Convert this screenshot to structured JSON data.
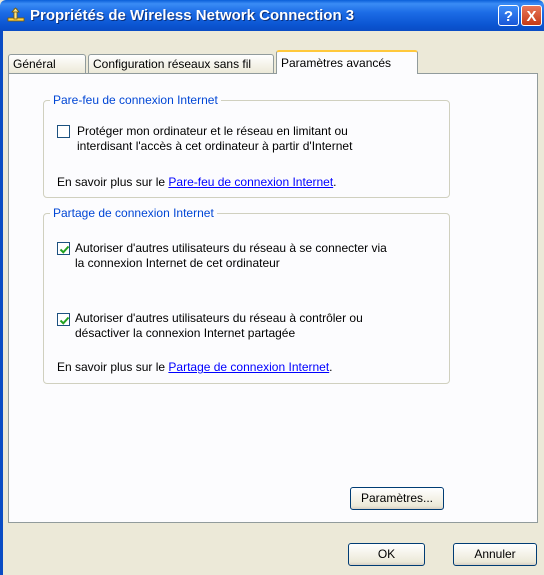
{
  "window": {
    "title": "Propriétés de Wireless Network Connection 3",
    "help_label": "?",
    "close_label": "X"
  },
  "tabs": [
    {
      "label": "Général"
    },
    {
      "label": "Configuration réseaux sans fil"
    },
    {
      "label": "Paramètres avancés",
      "active": true
    }
  ],
  "firewall": {
    "legend": "Pare-feu de connexion Internet",
    "checkbox_line1": "Protéger mon ordinateur et le réseau en limitant ou",
    "checkbox_line2": "interdisant l'accès à cet ordinateur à partir d'Internet",
    "checked": false,
    "learn_prefix": "En savoir plus sur le ",
    "learn_link": "Pare-feu de connexion Internet",
    "learn_suffix": "."
  },
  "sharing": {
    "legend": "Partage de connexion Internet",
    "opt1_line1": "Autoriser d'autres utilisateurs du réseau à se connecter via",
    "opt1_line2": "la connexion Internet de cet ordinateur",
    "opt1_checked": true,
    "opt2_line1": "Autoriser d'autres utilisateurs du réseau à contrôler ou",
    "opt2_line2": "désactiver la connexion Internet partagée",
    "opt2_checked": true,
    "learn_prefix": "En savoir plus sur le ",
    "learn_link": "Partage de connexion Internet",
    "learn_suffix": "."
  },
  "buttons": {
    "settings": "Paramètres...",
    "ok": "OK",
    "cancel": "Annuler"
  },
  "colors": {
    "titlebar": "#0a4cc4",
    "legend_text": "#0046d5",
    "link": "#0000ff",
    "check": "#21a121"
  }
}
